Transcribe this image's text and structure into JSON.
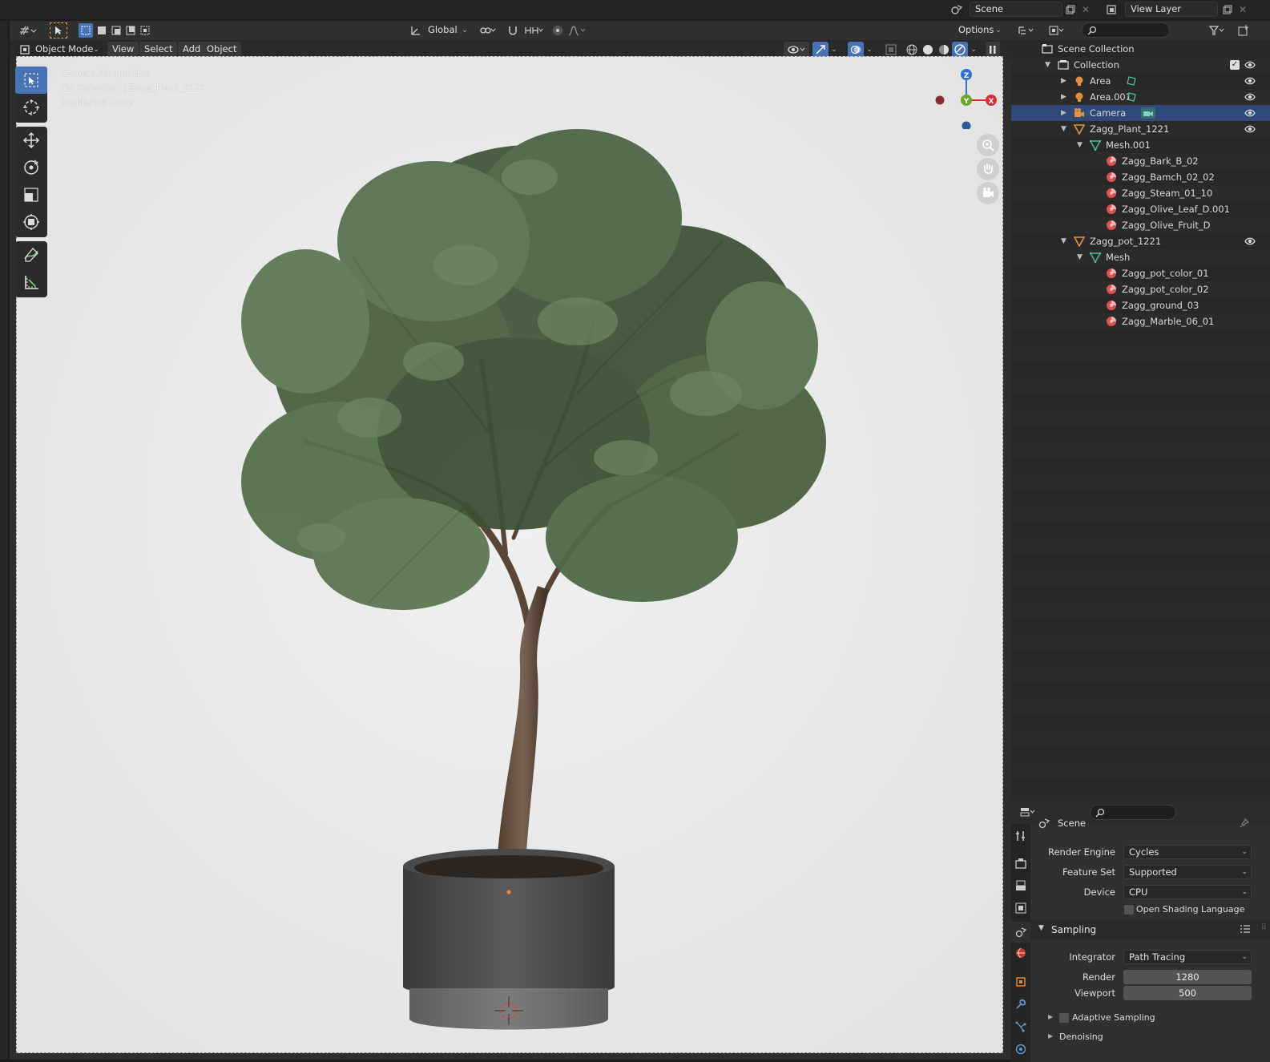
{
  "topbar": {
    "scene": "Scene",
    "view_layer": "View Layer"
  },
  "header": {
    "orientation": "Global",
    "options": "Options",
    "mode": "Object Mode",
    "menus": [
      "View",
      "Select",
      "Add",
      "Object"
    ]
  },
  "viewport": {
    "overlay": [
      "Camera Perspective",
      "(1) Collection | Zagg_Plant_1221",
      "Rendering Done"
    ],
    "gizmo": {
      "z": "Z",
      "y": "Y",
      "x": "X"
    }
  },
  "outliner": {
    "rows": [
      {
        "label": "Scene Collection",
        "icon": "scene-collection-icon"
      },
      {
        "label": "Collection",
        "icon": "collection-icon"
      },
      {
        "label": "Area",
        "icon": "light-icon"
      },
      {
        "label": "Area.001",
        "icon": "light-icon"
      },
      {
        "label": "Camera",
        "icon": "camera-icon"
      },
      {
        "label": "Zagg_Plant_1221",
        "icon": "mesh-object-icon"
      },
      {
        "label": "Mesh.001",
        "icon": "mesh-data-icon"
      },
      {
        "label": "Zagg_Bark_B_02",
        "icon": "material-icon"
      },
      {
        "label": "Zagg_Bamch_02_02",
        "icon": "material-icon"
      },
      {
        "label": "Zagg_Steam_01_10",
        "icon": "material-icon"
      },
      {
        "label": "Zagg_Olive_Leaf_D.001",
        "icon": "material-icon"
      },
      {
        "label": "Zagg_Olive_Fruit_D",
        "icon": "material-icon"
      },
      {
        "label": "Zagg_pot_1221",
        "icon": "mesh-object-icon"
      },
      {
        "label": "Mesh",
        "icon": "mesh-data-icon"
      },
      {
        "label": "Zagg_pot_color_01",
        "icon": "material-icon"
      },
      {
        "label": "Zagg_pot_color_02",
        "icon": "material-icon"
      },
      {
        "label": "Zagg_ground_03",
        "icon": "material-icon"
      },
      {
        "label": "Zagg_Marble_06_01",
        "icon": "material-icon"
      }
    ]
  },
  "properties": {
    "context": "Scene",
    "render_engine_label": "Render Engine",
    "render_engine": "Cycles",
    "feature_set_label": "Feature Set",
    "feature_set": "Supported",
    "device_label": "Device",
    "device": "CPU",
    "osl_label": "Open Shading Language",
    "sampling_label": "Sampling",
    "integrator_label": "Integrator",
    "integrator": "Path Tracing",
    "render_label": "Render",
    "render_samples": "1280",
    "viewport_label": "Viewport",
    "viewport_samples": "500",
    "adaptive_label": "Adaptive Sampling",
    "denoising_label": "Denoising"
  },
  "colors": {
    "accent": "#4772b3",
    "viewport_bg": "#e8e8e8",
    "selection": "#2f4a78"
  }
}
